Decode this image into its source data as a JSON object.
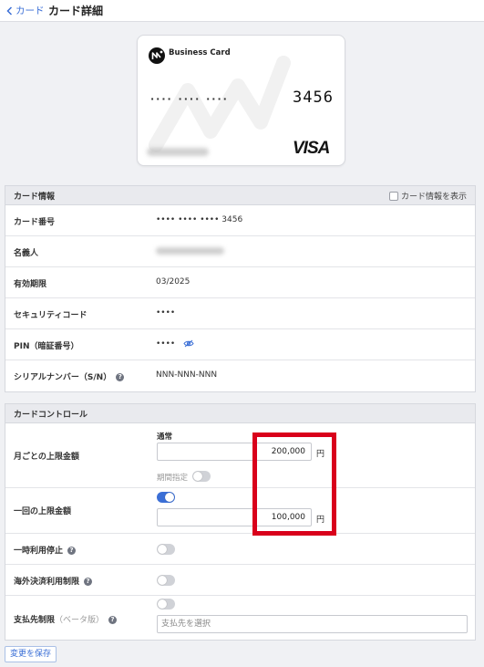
{
  "header": {
    "back_label": "カード",
    "title": "カード詳細"
  },
  "card": {
    "brand": "Business Card",
    "masked_dots": "···· ···· ····",
    "last4": "3456",
    "network": "VISA"
  },
  "card_info": {
    "title": "カード情報",
    "show_toggle_label": "カード情報を表示",
    "rows": [
      {
        "label": "カード番号",
        "value": "•••• •••• •••• 3456"
      },
      {
        "label": "名義人",
        "value": ""
      },
      {
        "label": "有効期限",
        "value": "03/2025"
      },
      {
        "label": "セキュリティコード",
        "value": "••••"
      },
      {
        "label": "PIN（暗証番号）",
        "value": "••••"
      },
      {
        "label": "シリアルナンバー（S/N）",
        "value": "NNN-NNN-NNN"
      }
    ]
  },
  "card_control": {
    "title": "カードコントロール",
    "monthly": {
      "label": "月ごとの上限金額",
      "sublabel": "通常",
      "value": "200,000",
      "unit": "円",
      "period_label": "期間指定",
      "period_enabled": false
    },
    "per_use": {
      "label": "一回の上限金額",
      "enabled": true,
      "value": "100,000",
      "unit": "円"
    },
    "suspend": {
      "label": "一時利用停止",
      "enabled": false
    },
    "overseas": {
      "label": "海外決済利用制限",
      "enabled": false
    },
    "payee": {
      "label": "支払先制限",
      "beta": "（ベータ版）",
      "enabled": false,
      "placeholder": "支払先を選択"
    }
  },
  "save_label": "変更を保存",
  "colors": {
    "accent": "#3b6fd6",
    "highlight": "#d9001b"
  }
}
